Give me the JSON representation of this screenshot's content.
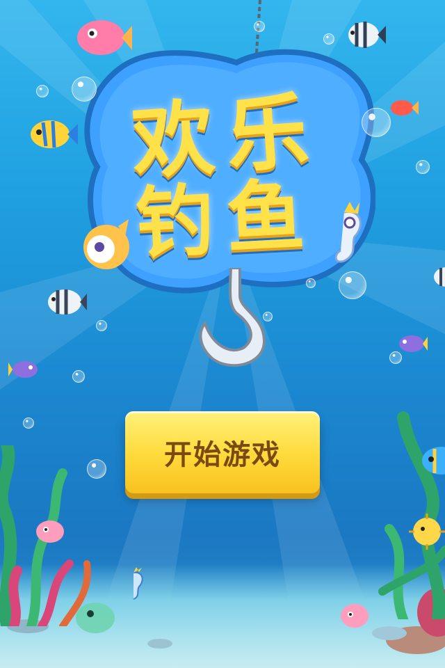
{
  "game": {
    "title_line1": "欢乐",
    "title_line2": "钓鱼",
    "start_button": "开始游戏"
  },
  "icons": {
    "hook": "fishing-hook-icon",
    "bubble": "bubble-icon"
  },
  "colors": {
    "water_top": "#33b6ee",
    "water_bottom": "#1b78c2",
    "title_fill": "#ffe24a",
    "title_cloud": "#3ea0ff",
    "button_fill": "#ffd93a",
    "button_text": "#7a4a12"
  }
}
